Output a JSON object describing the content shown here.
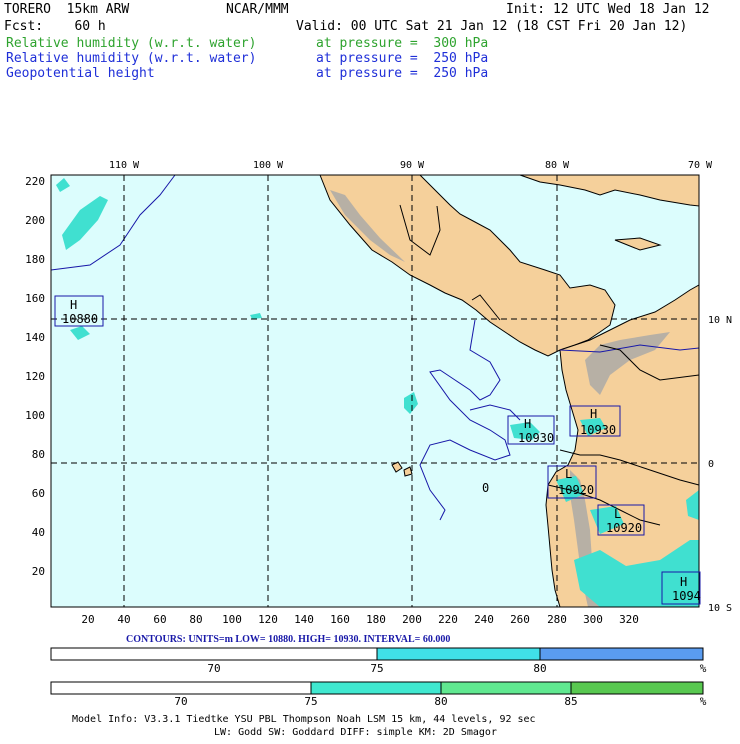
{
  "header": {
    "model": "TORERO  15km ARW",
    "center": "NCAR/MMM",
    "init": "Init: 12 UTC Wed 18 Jan 12",
    "fcst": "Fcst:    60 h",
    "valid": "Valid: 00 UTC Sat 21 Jan 12 (18 CST Fri 20 Jan 12)",
    "fields": [
      {
        "name": "Relative humidity (w.r.t. water)",
        "level": "at pressure =  300 hPa",
        "color": "#2ea32e"
      },
      {
        "name": "Relative humidity (w.r.t. water)",
        "level": "at pressure =  250 hPa",
        "color": "#1f2fd8"
      },
      {
        "name": "Geopotential height",
        "level": "at pressure =  250 hPa",
        "color": "#1f2fd8"
      }
    ]
  },
  "map": {
    "top_lon_labels": [
      "110 W",
      "100 W",
      "90 W",
      "80 W",
      "70 W"
    ],
    "right_lat_labels": [
      "10 N",
      "0",
      "10 S"
    ],
    "left_ticks": [
      "220",
      "200",
      "180",
      "160",
      "140",
      "120",
      "100",
      "80",
      "60",
      "40",
      "20"
    ],
    "bottom_ticks": [
      "20",
      "40",
      "60",
      "80",
      "100",
      "120",
      "140",
      "160",
      "180",
      "200",
      "220",
      "240",
      "260",
      "280",
      "300",
      "320"
    ],
    "colors": {
      "ocean": "#dcfdfd",
      "land": "#f5d09b",
      "terrain": "#a0a0a0",
      "rh_cyan": "#40e0d0",
      "contour": "#1818a8"
    },
    "centers": [
      {
        "type": "H",
        "value": "10880"
      },
      {
        "type": "H",
        "value": "10930"
      },
      {
        "type": "H",
        "value": "10930"
      },
      {
        "type": "L",
        "value": "10920"
      },
      {
        "type": "L",
        "value": "10920"
      },
      {
        "type": "H",
        "value": "1094"
      },
      {
        "type": "",
        "value": "0"
      }
    ]
  },
  "contours_line": "CONTOURS:  UNITS=m  LOW=  10880.    HIGH=  10930.    INTERVAL=  60.000",
  "colorbar_250": {
    "labels": [
      "70",
      "75",
      "80",
      "%"
    ],
    "colors": [
      "#ffffff",
      "#40e0e8",
      "#5a9cf0"
    ]
  },
  "colorbar_300": {
    "labels": [
      "70",
      "75",
      "80",
      "85",
      "%"
    ],
    "colors": [
      "#ffffff",
      "#40e8d0",
      "#60e890",
      "#58c850"
    ]
  },
  "footer": {
    "line1": "Model Info: V3.3.1   Tiedtke YSU PBL  Thompson    Noah LSM  15 km,   44 levels,   92 sec",
    "line2": "LW: Godd SW: Goddard DIFF: simple KM: 2D Smagor"
  }
}
